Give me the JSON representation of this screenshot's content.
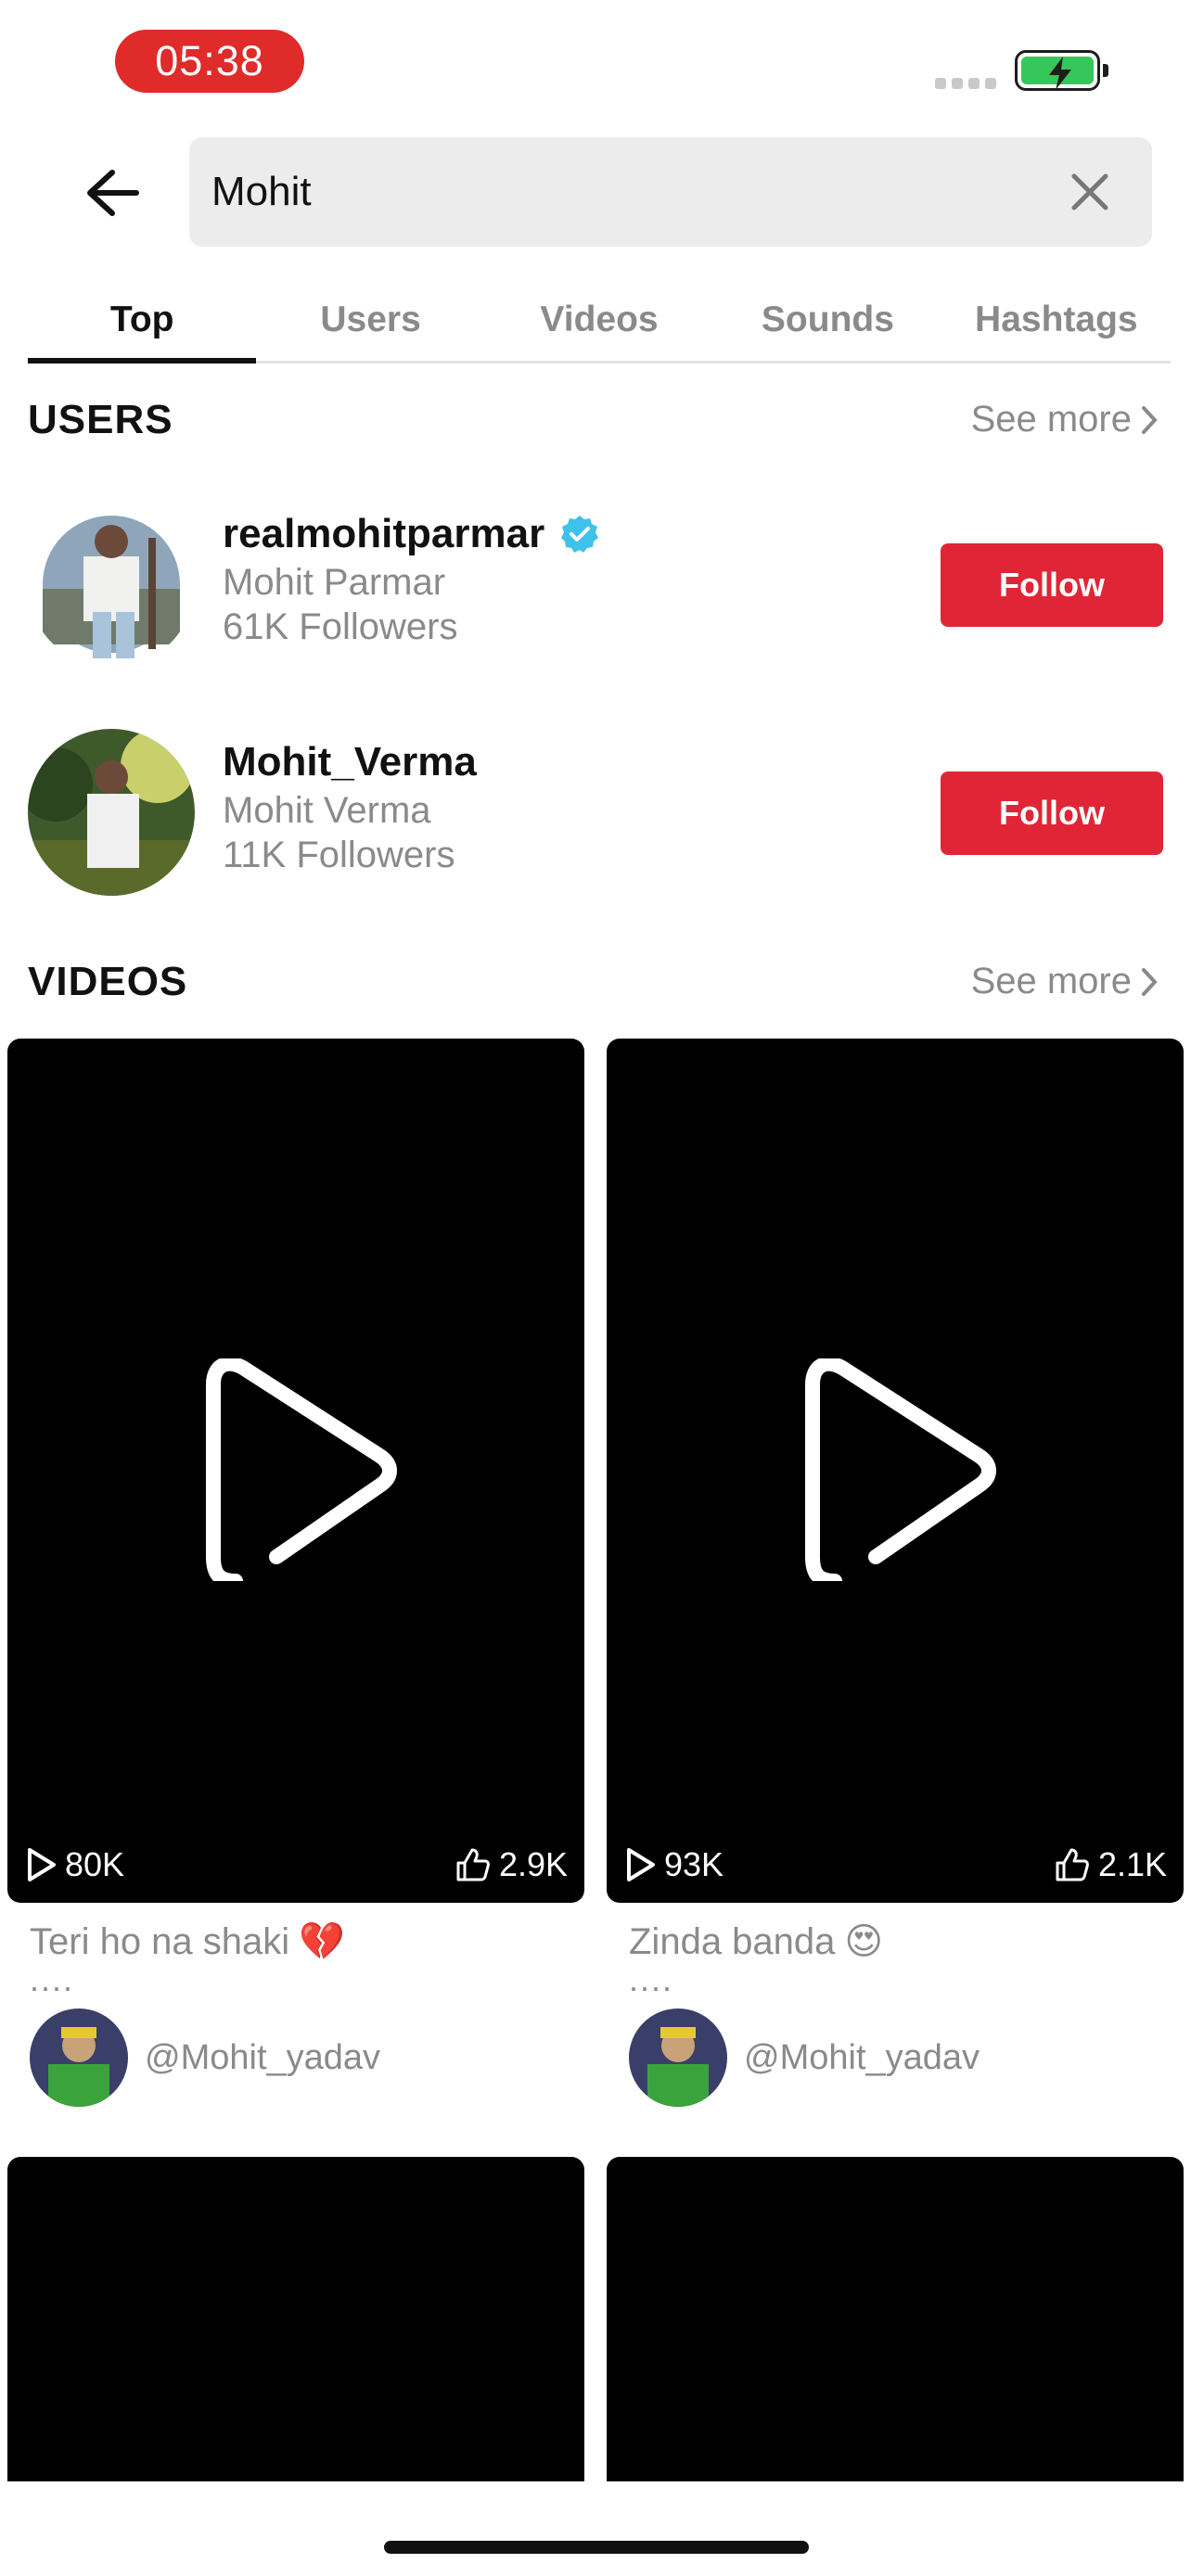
{
  "status_bar": {
    "time": "05:38"
  },
  "search": {
    "value": "Mohit"
  },
  "tabs": [
    {
      "label": "Top"
    },
    {
      "label": "Users"
    },
    {
      "label": "Videos"
    },
    {
      "label": "Sounds"
    },
    {
      "label": "Hashtags"
    }
  ],
  "users_section": {
    "title": "USERS",
    "see_more": "See more",
    "users": [
      {
        "username": "realmohitparmar",
        "verified": true,
        "display_name": "Mohit Parmar",
        "followers": "61K Followers",
        "follow_label": "Follow"
      },
      {
        "username": "Mohit_Verma",
        "verified": false,
        "display_name": "Mohit Verma",
        "followers": "11K Followers",
        "follow_label": "Follow"
      }
    ]
  },
  "videos_section": {
    "title": "VIDEOS",
    "see_more": "See more",
    "videos": [
      {
        "views": "80K",
        "likes": "2.9K",
        "title": "Teri ho na shaki",
        "emoji": "💔",
        "more": "....",
        "author": "@Mohit_yadav"
      },
      {
        "views": "93K",
        "likes": "2.1K",
        "title": "Zinda banda",
        "emoji": "😍",
        "more": "....",
        "author": "@Mohit_yadav"
      }
    ]
  },
  "colors": {
    "accent": "#e02636",
    "verified": "#3fc2ea",
    "muted": "#8a8a8a"
  }
}
